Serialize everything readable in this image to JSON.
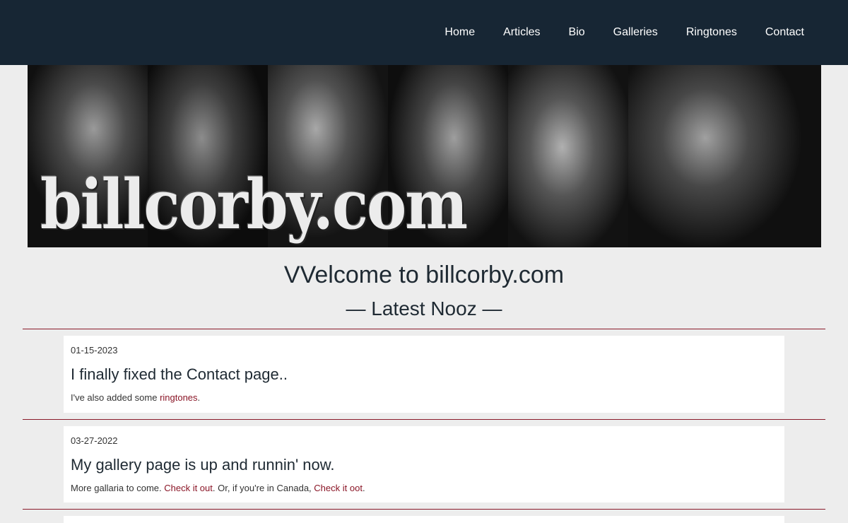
{
  "nav": {
    "items": [
      "Home",
      "Articles",
      "Bio",
      "Galleries",
      "Ringtones",
      "Contact"
    ]
  },
  "banner": {
    "logo_text": "billcorby.com"
  },
  "main": {
    "welcome": "VVelcome to billcorby.com",
    "latest_heading": "— Latest Nooz —"
  },
  "posts": [
    {
      "date": "01-15-2023",
      "title": "I finally fixed the Contact page..",
      "text_before": "I've also added some ",
      "link1": "ringtones",
      "text_after": "."
    },
    {
      "date": "03-27-2022",
      "title": "My gallery page is up and runnin' now.",
      "text_before": "More gallaria to come. ",
      "link1": "Check it out",
      "text_mid": ". Or, if you're in Canada, ",
      "link2": "Check it oot",
      "text_after": "."
    }
  ],
  "colors": {
    "topbar": "#172634",
    "accent": "#8a1526",
    "page_bg": "#ededed"
  }
}
